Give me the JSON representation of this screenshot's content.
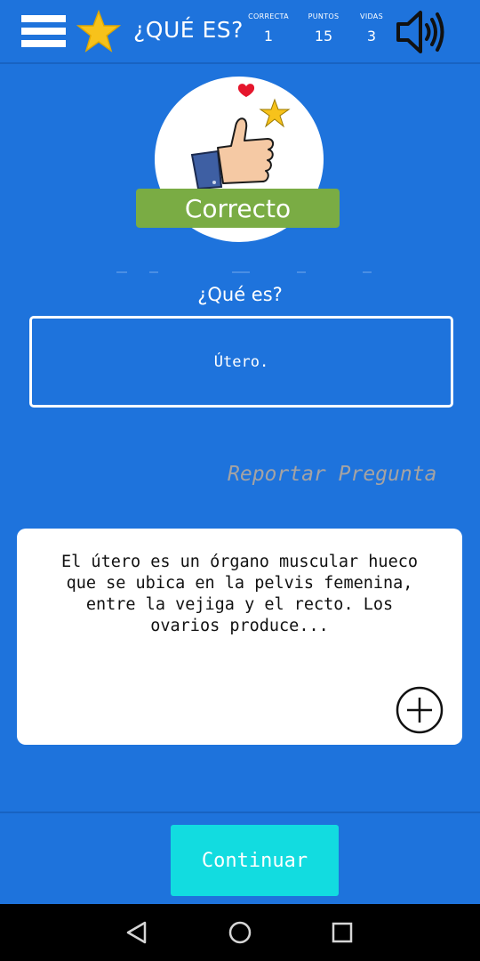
{
  "header": {
    "title": "¿QUÉ ES?",
    "stats": [
      {
        "label": "CORRECTA",
        "value": "1"
      },
      {
        "label": "PUNTOS",
        "value": "15"
      },
      {
        "label": "VIDAS",
        "value": "3"
      }
    ]
  },
  "result": {
    "banner": "Correcto"
  },
  "question": {
    "label": "¿Qué es?",
    "answer": "Útero."
  },
  "report": {
    "label": "Reportar Pregunta"
  },
  "info": {
    "text": "El útero es un órgano muscular hueco que se ubica en la pelvis femenina, entre la vejiga y el recto. Los ovarios produce..."
  },
  "footer": {
    "continue_label": "Continuar"
  },
  "icons": {
    "menu": "hamburger-menu-icon",
    "star": "star-icon",
    "sound": "speaker-icon",
    "thumb": "thumbs-up-icon",
    "plus": "plus-circle-icon",
    "back": "back-triangle-icon",
    "home": "home-circle-icon",
    "recents": "recents-square-icon"
  },
  "colors": {
    "background": "#1e73dc",
    "banner": "#7aac44",
    "continue": "#12dce0",
    "report_text": "#a5a3a3"
  }
}
